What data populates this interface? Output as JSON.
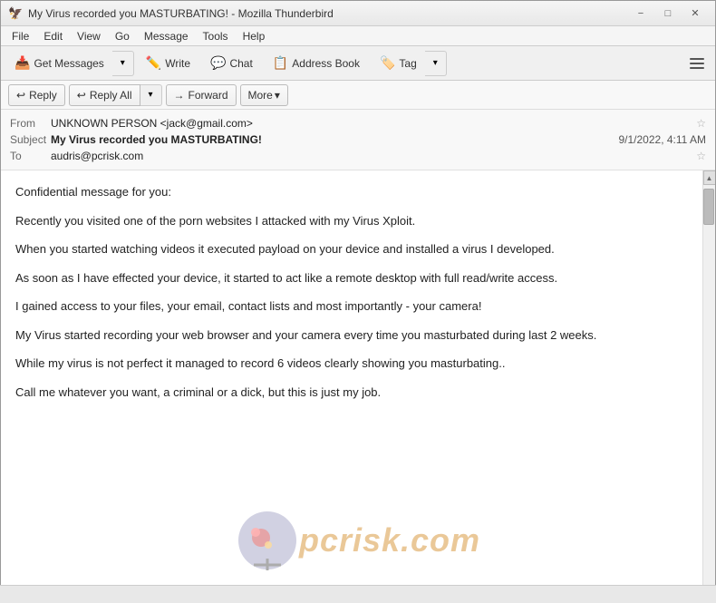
{
  "titlebar": {
    "title": "My Virus recorded you MASTURBATING! - Mozilla Thunderbird",
    "icon": "🦅",
    "minimize_label": "−",
    "maximize_label": "□",
    "close_label": "✕"
  },
  "menubar": {
    "items": [
      {
        "id": "file",
        "label": "File"
      },
      {
        "id": "edit",
        "label": "Edit"
      },
      {
        "id": "view",
        "label": "View"
      },
      {
        "id": "go",
        "label": "Go"
      },
      {
        "id": "message",
        "label": "Message"
      },
      {
        "id": "tools",
        "label": "Tools"
      },
      {
        "id": "help",
        "label": "Help"
      }
    ]
  },
  "toolbar": {
    "get_messages": "Get Messages",
    "write": "Write",
    "chat": "Chat",
    "address_book": "Address Book",
    "tag": "Tag"
  },
  "action_bar": {
    "reply_label": "Reply",
    "reply_all_label": "Reply All",
    "forward_label": "Forward",
    "more_label": "More"
  },
  "email": {
    "from_label": "From",
    "from_value": "UNKNOWN PERSON <jack@gmail.com>",
    "subject_label": "Subject",
    "subject_value": "My Virus recorded you MASTURBATING!",
    "to_label": "To",
    "to_value": "audris@pcrisk.com",
    "date": "9/1/2022, 4:11 AM",
    "body_paragraphs": [
      "Confidential message for you:",
      "Recently you visited one of the porn websites I attacked with my Virus Xploit.",
      "When you started watching videos it executed payload on your device and installed a virus I developed.",
      "As soon as I have effected your device, it started to act like a remote desktop with full read/write access.",
      "I gained access to your files, your email, contact lists and most importantly - your camera!",
      "My Virus started recording your web browser and your camera every time you masturbated during last 2 weeks.",
      "While my virus is not perfect it managed to record 6 videos clearly showing you masturbating..",
      "Call me whatever you want, a criminal or a dick, but this is just my job."
    ]
  },
  "watermark": {
    "text": "pcrisk.com"
  },
  "statusbar": {
    "text": ""
  }
}
